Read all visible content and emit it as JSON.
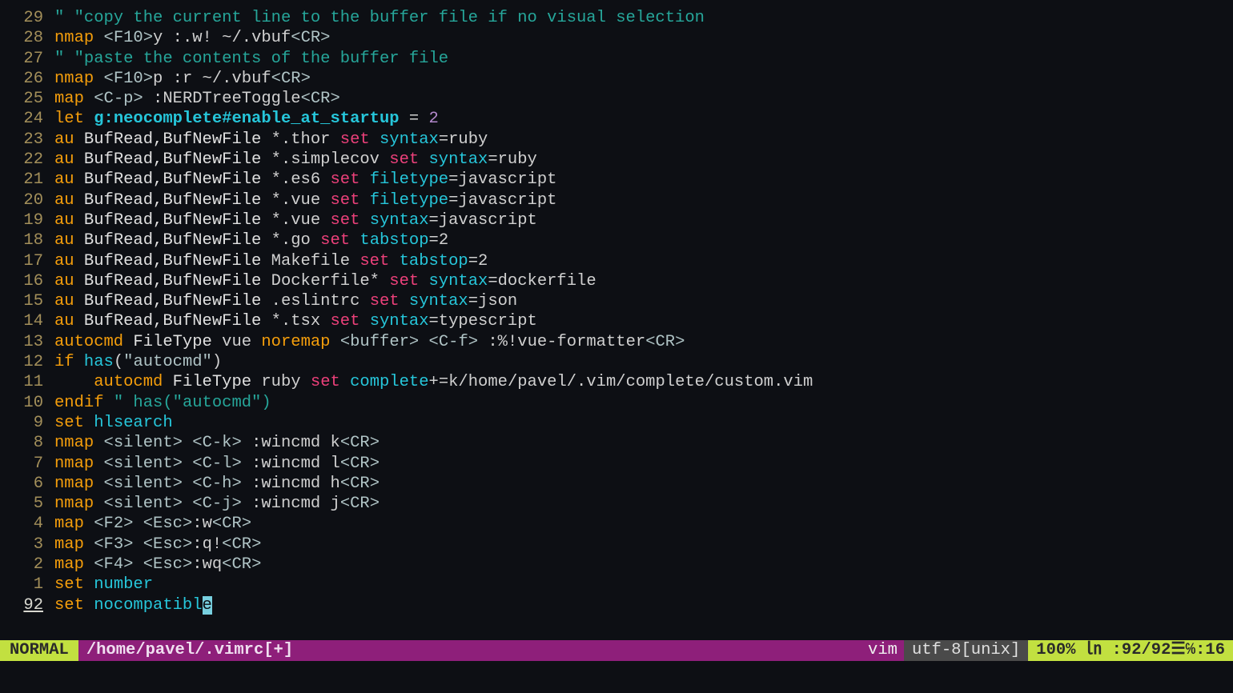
{
  "lines": [
    {
      "n": "29",
      "tokens": [
        [
          "c-comment",
          "\" \"copy the current line to the buffer file if no visual selection"
        ]
      ]
    },
    {
      "n": "28",
      "tokens": [
        [
          "c-key",
          "nmap"
        ],
        [
          "",
          " "
        ],
        [
          "c-angle",
          "<F10>"
        ],
        [
          "c-cmd",
          "y :.w! ~/.vbuf"
        ],
        [
          "c-angle",
          "<CR>"
        ]
      ]
    },
    {
      "n": "27",
      "tokens": [
        [
          "c-comment",
          "\" \"paste the contents of the buffer file"
        ]
      ]
    },
    {
      "n": "26",
      "tokens": [
        [
          "c-key",
          "nmap"
        ],
        [
          "",
          " "
        ],
        [
          "c-angle",
          "<F10>"
        ],
        [
          "c-cmd",
          "p :r ~/.vbuf"
        ],
        [
          "c-angle",
          "<CR>"
        ]
      ]
    },
    {
      "n": "25",
      "tokens": [
        [
          "c-key",
          "map"
        ],
        [
          "",
          " "
        ],
        [
          "c-angle",
          "<C-p>"
        ],
        [
          "c-cmd",
          " :NERDTreeToggle"
        ],
        [
          "c-angle",
          "<CR>"
        ]
      ]
    },
    {
      "n": "24",
      "tokens": [
        [
          "c-key",
          "let"
        ],
        [
          "",
          " "
        ],
        [
          "c-ident",
          "g:neocomplete#enable_at_startup"
        ],
        [
          "c-cmd",
          " = "
        ],
        [
          "c-num",
          "2"
        ]
      ]
    },
    {
      "n": "23",
      "tokens": [
        [
          "c-key",
          "au"
        ],
        [
          "c-white",
          " BufRead,BufNewFile "
        ],
        [
          "c-cmd",
          "*.thor "
        ],
        [
          "c-set",
          "set"
        ],
        [
          "",
          " "
        ],
        [
          "c-opt",
          "syntax"
        ],
        [
          "c-cmd",
          "=ruby"
        ]
      ]
    },
    {
      "n": "22",
      "tokens": [
        [
          "c-key",
          "au"
        ],
        [
          "c-white",
          " BufRead,BufNewFile "
        ],
        [
          "c-cmd",
          "*.simplecov "
        ],
        [
          "c-set",
          "set"
        ],
        [
          "",
          " "
        ],
        [
          "c-opt",
          "syntax"
        ],
        [
          "c-cmd",
          "=ruby"
        ]
      ]
    },
    {
      "n": "21",
      "tokens": [
        [
          "c-key",
          "au"
        ],
        [
          "c-white",
          " BufRead,BufNewFile "
        ],
        [
          "c-cmd",
          "*.es6 "
        ],
        [
          "c-set",
          "set"
        ],
        [
          "",
          " "
        ],
        [
          "c-opt",
          "filetype"
        ],
        [
          "c-cmd",
          "=javascript"
        ]
      ]
    },
    {
      "n": "20",
      "tokens": [
        [
          "c-key",
          "au"
        ],
        [
          "c-white",
          " BufRead,BufNewFile "
        ],
        [
          "c-cmd",
          "*.vue "
        ],
        [
          "c-set",
          "set"
        ],
        [
          "",
          " "
        ],
        [
          "c-opt",
          "filetype"
        ],
        [
          "c-cmd",
          "=javascript"
        ]
      ]
    },
    {
      "n": "19",
      "tokens": [
        [
          "c-key",
          "au"
        ],
        [
          "c-white",
          " BufRead,BufNewFile "
        ],
        [
          "c-cmd",
          "*.vue "
        ],
        [
          "c-set",
          "set"
        ],
        [
          "",
          " "
        ],
        [
          "c-opt",
          "syntax"
        ],
        [
          "c-cmd",
          "=javascript"
        ]
      ]
    },
    {
      "n": "18",
      "tokens": [
        [
          "c-key",
          "au"
        ],
        [
          "c-white",
          " BufRead,BufNewFile "
        ],
        [
          "c-cmd",
          "*.go "
        ],
        [
          "c-set",
          "set"
        ],
        [
          "",
          " "
        ],
        [
          "c-opt",
          "tabstop"
        ],
        [
          "c-cmd",
          "=2"
        ]
      ]
    },
    {
      "n": "17",
      "tokens": [
        [
          "c-key",
          "au"
        ],
        [
          "c-white",
          " BufRead,BufNewFile "
        ],
        [
          "c-cmd",
          "Makefile "
        ],
        [
          "c-set",
          "set"
        ],
        [
          "",
          " "
        ],
        [
          "c-opt",
          "tabstop"
        ],
        [
          "c-cmd",
          "=2"
        ]
      ]
    },
    {
      "n": "16",
      "tokens": [
        [
          "c-key",
          "au"
        ],
        [
          "c-white",
          " BufRead,BufNewFile "
        ],
        [
          "c-cmd",
          "Dockerfile* "
        ],
        [
          "c-set",
          "set"
        ],
        [
          "",
          " "
        ],
        [
          "c-opt",
          "syntax"
        ],
        [
          "c-cmd",
          "=dockerfile"
        ]
      ]
    },
    {
      "n": "15",
      "tokens": [
        [
          "c-key",
          "au"
        ],
        [
          "c-white",
          " BufRead,BufNewFile "
        ],
        [
          "c-cmd",
          ".eslintrc "
        ],
        [
          "c-set",
          "set"
        ],
        [
          "",
          " "
        ],
        [
          "c-opt",
          "syntax"
        ],
        [
          "c-cmd",
          "=json"
        ]
      ]
    },
    {
      "n": "14",
      "tokens": [
        [
          "c-key",
          "au"
        ],
        [
          "c-white",
          " BufRead,BufNewFile "
        ],
        [
          "c-cmd",
          "*.tsx "
        ],
        [
          "c-set",
          "set"
        ],
        [
          "",
          " "
        ],
        [
          "c-opt",
          "syntax"
        ],
        [
          "c-cmd",
          "=typescript"
        ]
      ]
    },
    {
      "n": "13",
      "tokens": [
        [
          "c-key",
          "autocmd"
        ],
        [
          "c-white",
          " FileType "
        ],
        [
          "c-cmd",
          "vue "
        ],
        [
          "c-key",
          "noremap"
        ],
        [
          "",
          " "
        ],
        [
          "c-angle",
          "<buffer>"
        ],
        [
          "",
          " "
        ],
        [
          "c-angle",
          "<C-f>"
        ],
        [
          "c-cmd",
          " :%!vue-formatter"
        ],
        [
          "c-angle",
          "<CR>"
        ]
      ]
    },
    {
      "n": "12",
      "tokens": [
        [
          "c-key",
          "if"
        ],
        [
          "",
          " "
        ],
        [
          "c-func",
          "has"
        ],
        [
          "c-cmd",
          "("
        ],
        [
          "c-str",
          "\"autocmd\""
        ],
        [
          "c-cmd",
          ")"
        ]
      ]
    },
    {
      "n": "11",
      "tokens": [
        [
          "",
          "    "
        ],
        [
          "c-key",
          "autocmd"
        ],
        [
          "c-white",
          " FileType "
        ],
        [
          "c-cmd",
          "ruby "
        ],
        [
          "c-set",
          "set"
        ],
        [
          "",
          " "
        ],
        [
          "c-opt",
          "complete"
        ],
        [
          "c-cmd",
          "+=k/home/pavel/.vim/complete/custom.vim"
        ]
      ]
    },
    {
      "n": "10",
      "tokens": [
        [
          "c-key",
          "endif"
        ],
        [
          "",
          " "
        ],
        [
          "c-comment",
          "\" has(\"autocmd\")"
        ]
      ]
    },
    {
      "n": "9",
      "tokens": [
        [
          "c-key",
          "set"
        ],
        [
          "",
          " "
        ],
        [
          "c-opt",
          "hlsearch"
        ]
      ]
    },
    {
      "n": "8",
      "tokens": [
        [
          "c-key",
          "nmap"
        ],
        [
          "",
          " "
        ],
        [
          "c-angle",
          "<silent>"
        ],
        [
          "",
          " "
        ],
        [
          "c-angle",
          "<C-k>"
        ],
        [
          "c-cmd",
          " :wincmd k"
        ],
        [
          "c-angle",
          "<CR>"
        ]
      ]
    },
    {
      "n": "7",
      "tokens": [
        [
          "c-key",
          "nmap"
        ],
        [
          "",
          " "
        ],
        [
          "c-angle",
          "<silent>"
        ],
        [
          "",
          " "
        ],
        [
          "c-angle",
          "<C-l>"
        ],
        [
          "c-cmd",
          " :wincmd l"
        ],
        [
          "c-angle",
          "<CR>"
        ]
      ]
    },
    {
      "n": "6",
      "tokens": [
        [
          "c-key",
          "nmap"
        ],
        [
          "",
          " "
        ],
        [
          "c-angle",
          "<silent>"
        ],
        [
          "",
          " "
        ],
        [
          "c-angle",
          "<C-h>"
        ],
        [
          "c-cmd",
          " :wincmd h"
        ],
        [
          "c-angle",
          "<CR>"
        ]
      ]
    },
    {
      "n": "5",
      "tokens": [
        [
          "c-key",
          "nmap"
        ],
        [
          "",
          " "
        ],
        [
          "c-angle",
          "<silent>"
        ],
        [
          "",
          " "
        ],
        [
          "c-angle",
          "<C-j>"
        ],
        [
          "c-cmd",
          " :wincmd j"
        ],
        [
          "c-angle",
          "<CR>"
        ]
      ]
    },
    {
      "n": "4",
      "tokens": [
        [
          "c-key",
          "map"
        ],
        [
          "",
          " "
        ],
        [
          "c-angle",
          "<F2>"
        ],
        [
          "",
          " "
        ],
        [
          "c-angle",
          "<Esc>"
        ],
        [
          "c-cmd",
          ":w"
        ],
        [
          "c-angle",
          "<CR>"
        ]
      ]
    },
    {
      "n": "3",
      "tokens": [
        [
          "c-key",
          "map"
        ],
        [
          "",
          " "
        ],
        [
          "c-angle",
          "<F3>"
        ],
        [
          "",
          " "
        ],
        [
          "c-angle",
          "<Esc>"
        ],
        [
          "c-cmd",
          ":q!"
        ],
        [
          "c-angle",
          "<CR>"
        ]
      ]
    },
    {
      "n": "2",
      "tokens": [
        [
          "c-key",
          "map"
        ],
        [
          "",
          " "
        ],
        [
          "c-angle",
          "<F4>"
        ],
        [
          "",
          " "
        ],
        [
          "c-angle",
          "<Esc>"
        ],
        [
          "c-cmd",
          ":wq"
        ],
        [
          "c-angle",
          "<CR>"
        ]
      ]
    },
    {
      "n": "1",
      "tokens": [
        [
          "c-key",
          "set"
        ],
        [
          "",
          " "
        ],
        [
          "c-opt",
          "number"
        ]
      ]
    },
    {
      "n": "92",
      "current": true,
      "tokens": [
        [
          "c-key",
          "set"
        ],
        [
          "",
          " "
        ],
        [
          "c-opt",
          "nocompatibl"
        ],
        [
          "cursor-block",
          "e"
        ]
      ]
    }
  ],
  "status": {
    "mode": "NORMAL",
    "file": "/home/pavel/.vimrc[+]",
    "filetype": "vim",
    "encoding": "utf-8[unix]",
    "position": "100% ㏑ :92/92☰℅:16"
  }
}
